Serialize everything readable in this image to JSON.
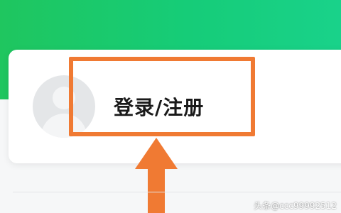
{
  "header": {
    "accent_color": "#1fc65f"
  },
  "account": {
    "avatar_icon": "default-user-avatar",
    "login_label": "登录/注册"
  },
  "annotation": {
    "highlight_color": "#f07a33",
    "arrow_icon": "arrow-up-icon"
  },
  "watermark": "头条@ccc99992512"
}
